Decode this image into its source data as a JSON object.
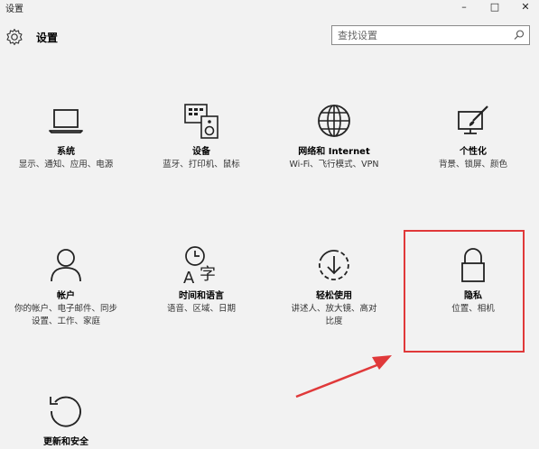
{
  "window": {
    "title": "设置",
    "minimize": "–",
    "maximize": "□",
    "close": "✕"
  },
  "header": {
    "title": "设置",
    "icon": "gear-icon"
  },
  "search": {
    "placeholder": "查找设置",
    "icon": "search-icon"
  },
  "tiles": [
    {
      "name": "系统",
      "desc": "显示、通知、应用、电源",
      "icon": "laptop-icon"
    },
    {
      "name": "设备",
      "desc": "蓝牙、打印机、鼠标",
      "icon": "devices-icon"
    },
    {
      "name": "网络和 Internet",
      "desc": "Wi-Fi、飞行模式、VPN",
      "icon": "globe-icon"
    },
    {
      "name": "个性化",
      "desc": "背景、锁屏、颜色",
      "icon": "paint-icon"
    },
    {
      "name": "帐户",
      "desc": "你的帐户、电子邮件、同步设置、工作、家庭",
      "icon": "person-icon"
    },
    {
      "name": "时间和语言",
      "desc": "语音、区域、日期",
      "icon": "time-language-icon"
    },
    {
      "name": "轻松使用",
      "desc": "讲述人、放大镜、高对比度",
      "icon": "ease-of-access-icon"
    },
    {
      "name": "隐私",
      "desc": "位置、相机",
      "icon": "lock-icon"
    },
    {
      "name": "更新和安全",
      "desc": "",
      "icon": "update-icon"
    }
  ],
  "colors": {
    "background": "#f2f2f2",
    "highlight": "#e0393a"
  }
}
